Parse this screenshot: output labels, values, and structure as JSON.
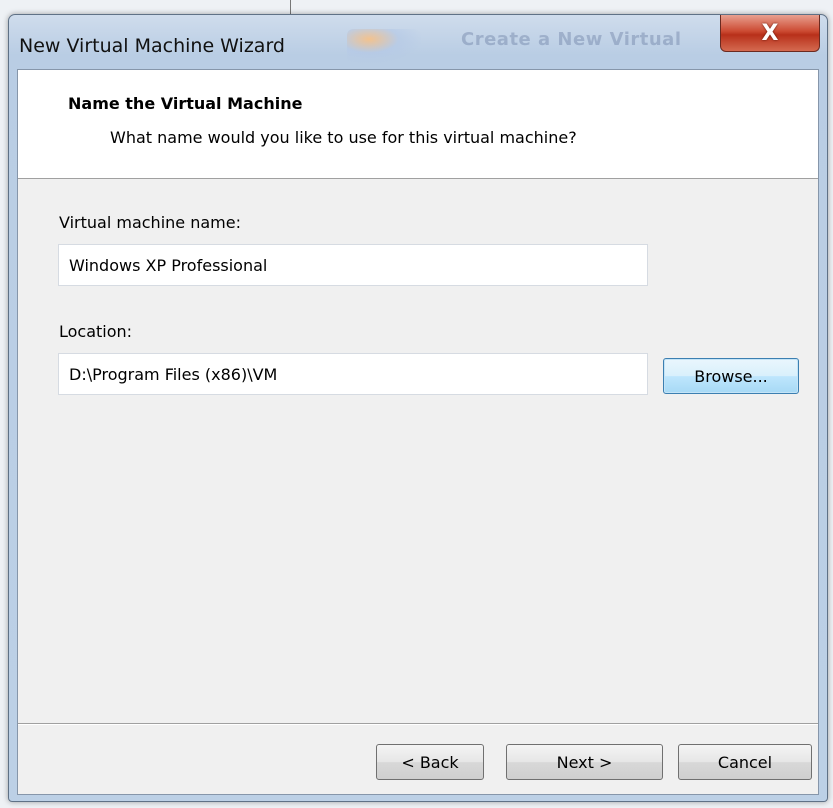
{
  "window": {
    "title": "New Virtual Machine Wizard",
    "background_title": "Create a New Virtual",
    "close_symbol": "X"
  },
  "header": {
    "title": "Name the Virtual Machine",
    "subtitle": "What name would you like to use for this virtual machine?"
  },
  "form": {
    "name_label": "Virtual machine name:",
    "name_value": "Windows XP Professional",
    "location_label": "Location:",
    "location_value": "D:\\Program Files (x86)\\VM",
    "browse_label": "Browse..."
  },
  "footer": {
    "back_label": "< Back",
    "next_label": "Next >",
    "cancel_label": "Cancel"
  },
  "colors": {
    "focus_button": "#bee6fd",
    "close_button": "#cc4a32"
  }
}
